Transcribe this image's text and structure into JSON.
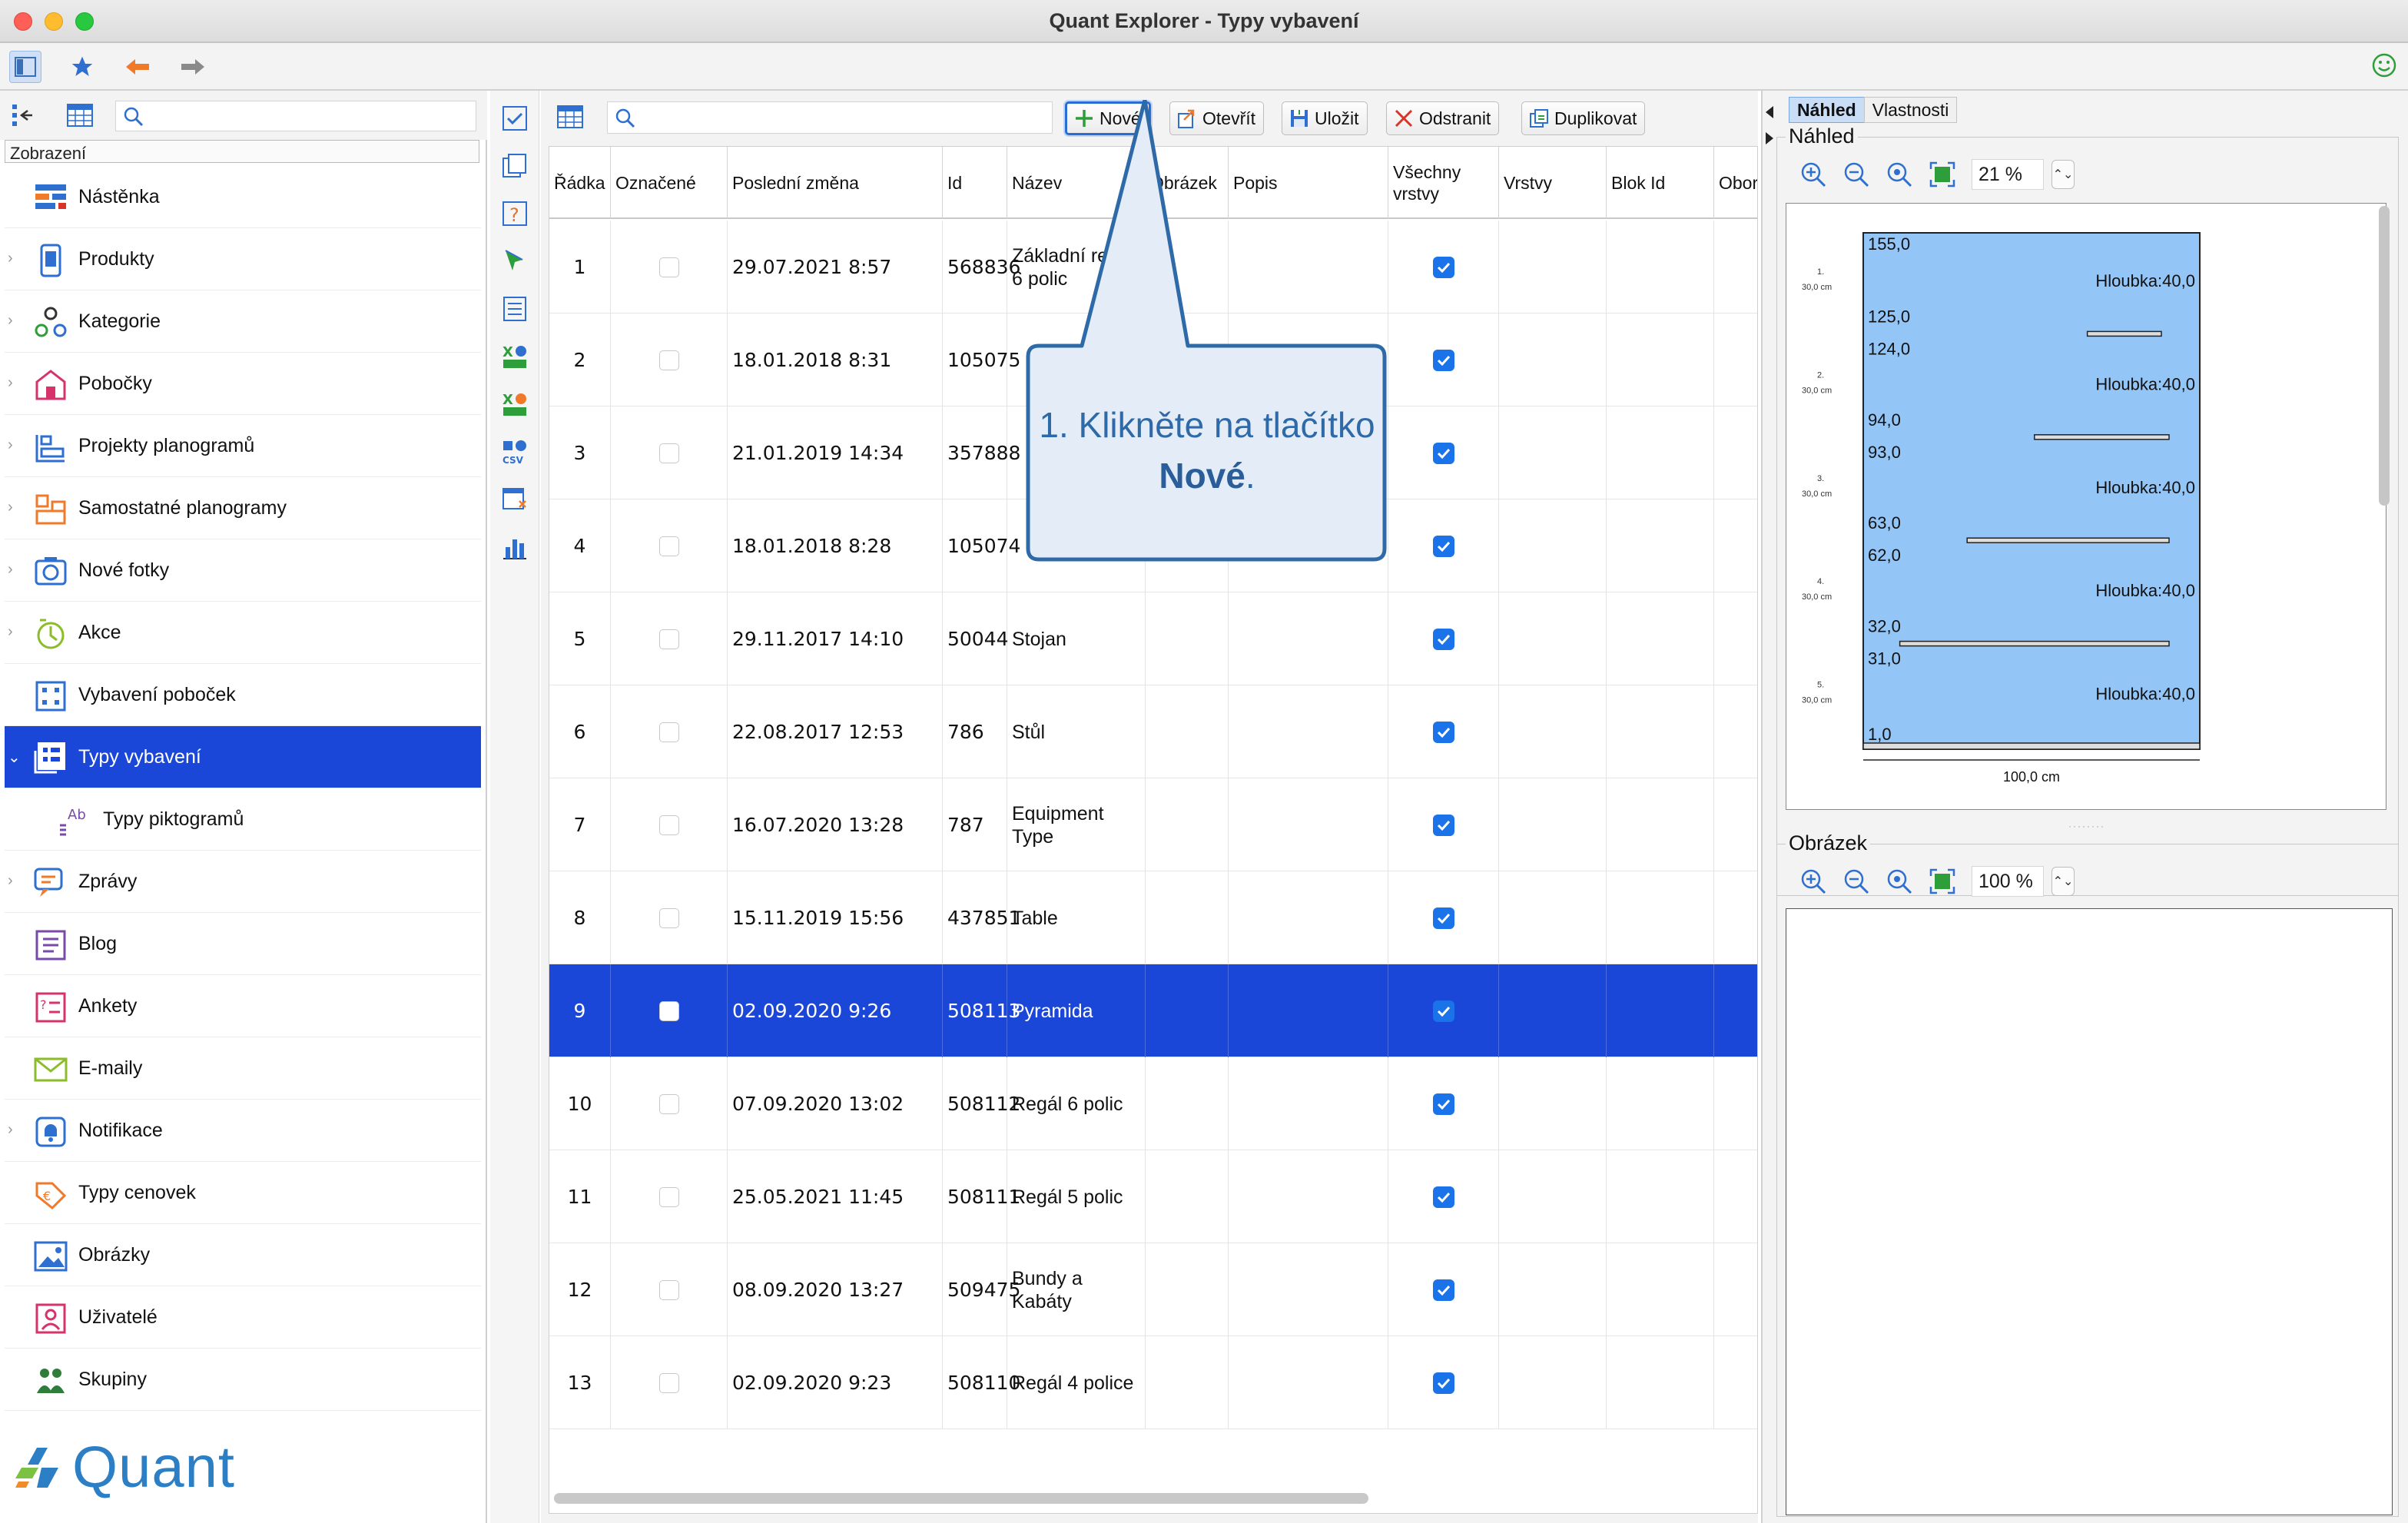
{
  "window": {
    "title": "Quant Explorer - Typy vybavení"
  },
  "sidebar": {
    "header": "Zobrazení",
    "items": [
      {
        "label": "Nástěnka",
        "icon": "dashboard-icon",
        "expandable": false
      },
      {
        "label": "Produkty",
        "icon": "product-icon",
        "expandable": true
      },
      {
        "label": "Kategorie",
        "icon": "category-icon",
        "expandable": true
      },
      {
        "label": "Pobočky",
        "icon": "store-icon",
        "expandable": true
      },
      {
        "label": "Projekty planogramů",
        "icon": "planogram-project-icon",
        "expandable": true
      },
      {
        "label": "Samostatné planogramy",
        "icon": "planogram-icon",
        "expandable": true
      },
      {
        "label": "Nové fotky",
        "icon": "camera-icon",
        "expandable": true
      },
      {
        "label": "Akce",
        "icon": "promotion-icon",
        "expandable": true
      },
      {
        "label": "Vybavení poboček",
        "icon": "equipment-icon",
        "expandable": false
      },
      {
        "label": "Typy vybavení",
        "icon": "equipment-type-icon",
        "expandable": true,
        "active": true
      },
      {
        "label": "Typy piktogramů",
        "icon": "pictogram-icon",
        "expandable": false,
        "sub": true
      },
      {
        "label": "Zprávy",
        "icon": "message-icon",
        "expandable": true
      },
      {
        "label": "Blog",
        "icon": "blog-icon",
        "expandable": false
      },
      {
        "label": "Ankety",
        "icon": "survey-icon",
        "expandable": false
      },
      {
        "label": "E-maily",
        "icon": "email-icon",
        "expandable": false
      },
      {
        "label": "Notifikace",
        "icon": "bell-icon",
        "expandable": true
      },
      {
        "label": "Typy cenovek",
        "icon": "price-tag-icon",
        "expandable": false
      },
      {
        "label": "Obrázky",
        "icon": "image-icon",
        "expandable": false
      },
      {
        "label": "Uživatelé",
        "icon": "user-icon",
        "expandable": false
      },
      {
        "label": "Skupiny",
        "icon": "group-icon",
        "expandable": false
      }
    ],
    "logo_text": "Quant"
  },
  "main": {
    "actions": {
      "new": "Nové",
      "open": "Otevřít",
      "save": "Uložit",
      "delete": "Odstranit",
      "duplicate": "Duplikovat"
    },
    "columns": [
      "Řádka",
      "Označené",
      "Poslední změna",
      "Id",
      "Název",
      "Obrázek",
      "Popis",
      "Všechny vrstvy",
      "Vrstvy",
      "Blok Id",
      "Obor"
    ],
    "rows": [
      {
        "row": "1",
        "marked": false,
        "changed": "29.07.2021 8:57",
        "id": "568836",
        "name": "Základní regál 6 polic",
        "all_layers": true
      },
      {
        "row": "2",
        "marked": false,
        "changed": "18.01.2018 8:31",
        "id": "105075",
        "name": "",
        "all_layers": true
      },
      {
        "row": "3",
        "marked": false,
        "changed": "21.01.2019 14:34",
        "id": "357888",
        "name": "",
        "all_layers": true
      },
      {
        "row": "4",
        "marked": false,
        "changed": "18.01.2018 8:28",
        "id": "105074",
        "name": "",
        "all_layers": true
      },
      {
        "row": "5",
        "marked": false,
        "changed": "29.11.2017 14:10",
        "id": "50044",
        "name": "Stojan",
        "all_layers": true
      },
      {
        "row": "6",
        "marked": false,
        "changed": "22.08.2017 12:53",
        "id": "786",
        "name": "Stůl",
        "all_layers": true
      },
      {
        "row": "7",
        "marked": false,
        "changed": "16.07.2020 13:28",
        "id": "787",
        "name": "Equipment Type",
        "all_layers": true
      },
      {
        "row": "8",
        "marked": false,
        "changed": "15.11.2019 15:56",
        "id": "437851",
        "name": "Table",
        "all_layers": true
      },
      {
        "row": "9",
        "marked": false,
        "changed": "02.09.2020 9:26",
        "id": "508113",
        "name": "Pyramida",
        "all_layers": true,
        "selected": true
      },
      {
        "row": "10",
        "marked": false,
        "changed": "07.09.2020 13:02",
        "id": "508112",
        "name": "Regál 6 polic",
        "all_layers": true
      },
      {
        "row": "11",
        "marked": false,
        "changed": "25.05.2021 11:45",
        "id": "508111",
        "name": "Regál 5 polic",
        "all_layers": true
      },
      {
        "row": "12",
        "marked": false,
        "changed": "08.09.2020 13:27",
        "id": "509475",
        "name": "Bundy a Kabáty",
        "all_layers": true
      },
      {
        "row": "13",
        "marked": false,
        "changed": "02.09.2020 9:23",
        "id": "508110",
        "name": "Regál 4 police",
        "all_layers": true
      }
    ],
    "callout": {
      "text_before": "1. Klikněte na tlačítko ",
      "text_bold": "Nové",
      "text_after": "."
    }
  },
  "right": {
    "tabs": [
      "Náhled",
      "Vlastnosti"
    ],
    "preview_title": "Náhled",
    "preview_zoom": "21 %",
    "image_title": "Obrázek",
    "image_zoom": "100 %",
    "shelf_preview": {
      "width_label": "100,0 cm",
      "depth_label": "Hloubka:40,0",
      "levels": [
        "155,0",
        "125,0",
        "124,0",
        "94,0",
        "93,0",
        "63,0",
        "62,0",
        "32,0",
        "31,0",
        "1,0"
      ],
      "sections": [
        "1.",
        "2.",
        "3.",
        "4.",
        "5."
      ],
      "section_height": "30,0 cm"
    }
  },
  "colors": {
    "selection": "#1b47d8",
    "accent": "#2a6ccf",
    "checkbox": "#1a73e8",
    "preview_fill": "#93c5f7"
  }
}
